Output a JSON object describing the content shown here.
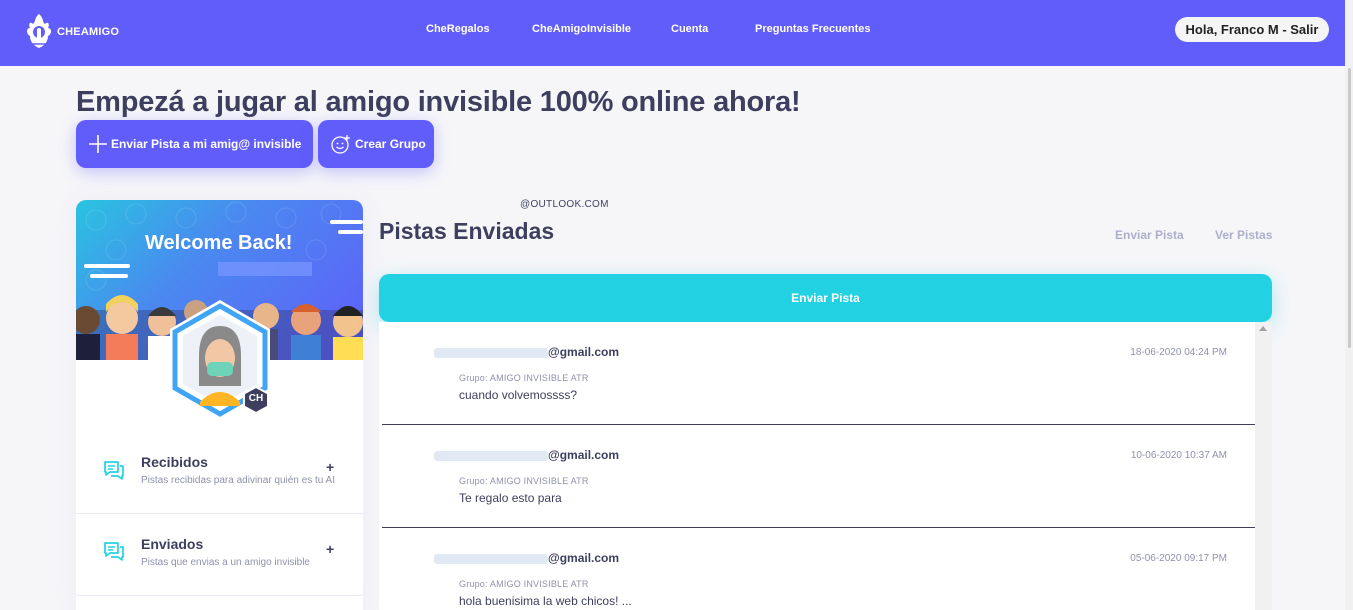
{
  "brand": {
    "name": "CHEAMIGO",
    "primary": "#615dfa",
    "accent": "#23d2e2",
    "text": "#3e3f5e"
  },
  "nav": {
    "links": [
      "CheRegalos",
      "CheAmigoInvisible",
      "Cuenta",
      "Preguntas Frecuentes"
    ],
    "user_greeting": "Hola, Franco M - Salir"
  },
  "hero": {
    "title": "Empezá a jugar al amigo invisible 100% online ahora!",
    "buttons": [
      {
        "label": "Enviar Pista a mi amig@ invisible",
        "icon": "plus-icon"
      },
      {
        "label": "Crear Grupo",
        "icon": "smiley-add-icon"
      }
    ]
  },
  "profile": {
    "welcome": "Welcome Back!",
    "level_badge": "CH",
    "menu": [
      {
        "title": "Recibidos",
        "description": "Pistas recibidas para adivinar quién es tu AI",
        "icon": "chat-icon"
      },
      {
        "title": "Enviados",
        "description": "Pistas que envias a un amigo invisible",
        "icon": "chat-icon"
      }
    ]
  },
  "main": {
    "email_tag": "@OUTLOOK.COM",
    "section_title": "Pistas Enviadas",
    "tabs": [
      "Enviar Pista",
      "Ver Pistas"
    ],
    "send_button": "Enviar Pista",
    "messages": [
      {
        "email": "@gmail.com",
        "date": "18-06-2020 04:24 PM",
        "group": "Grupo: AMIGO INVISIBLE ATR",
        "text": "cuando volvemossss?"
      },
      {
        "email": "@gmail.com",
        "date": "10-06-2020 10:37 AM",
        "group": "Grupo: AMIGO INVISIBLE ATR",
        "text": "Te regalo esto para"
      },
      {
        "email": "@gmail.com",
        "date": "05-06-2020 09:17 PM",
        "group": "Grupo: AMIGO INVISIBLE ATR",
        "text": "hola buenisima la web chicos! ..."
      }
    ]
  }
}
